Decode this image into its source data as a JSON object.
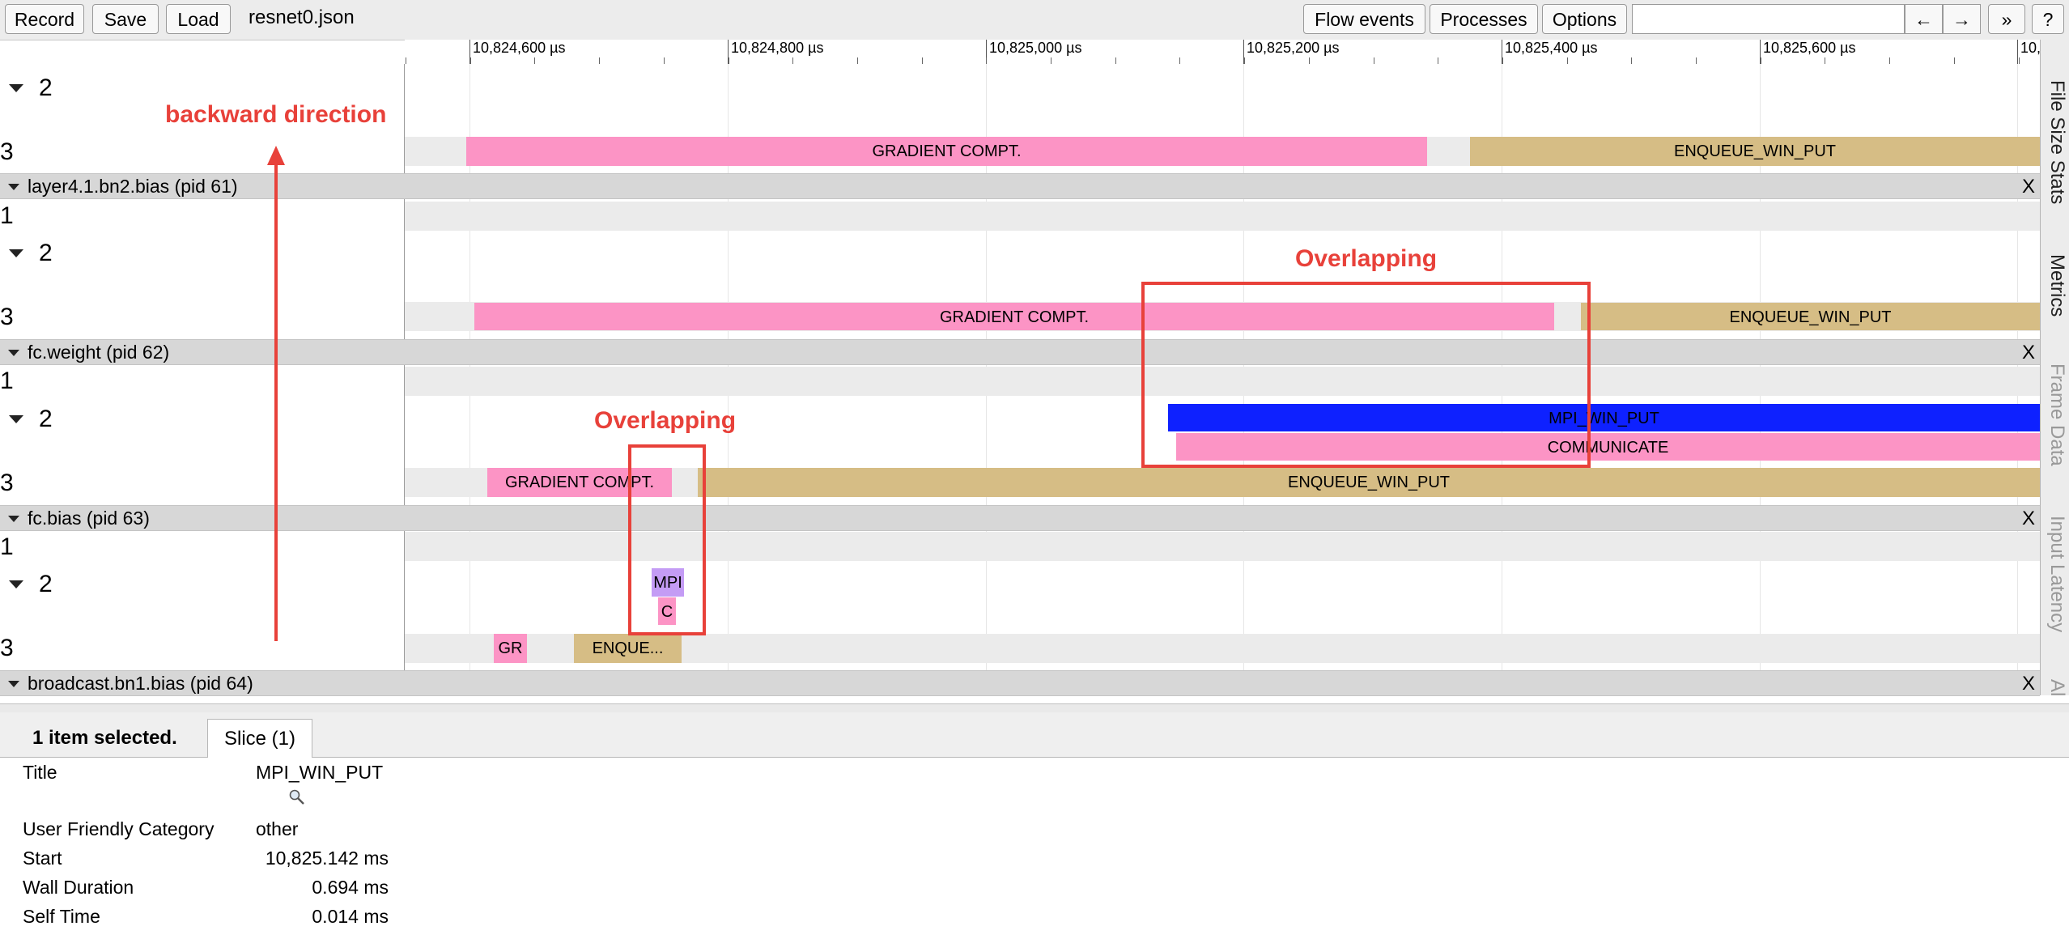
{
  "toolbar": {
    "record_label": "Record",
    "save_label": "Save",
    "load_label": "Load",
    "filename": "resnet0.json",
    "flow_events_label": "Flow events",
    "processes_label": "Processes",
    "options_label": "Options",
    "search_value": "",
    "prev_label": "←",
    "next_label": "→",
    "more_label": "»",
    "help_label": "?"
  },
  "ruler": {
    "ticks": [
      "10,824,600 µs",
      "10,824,800 µs",
      "10,825,000 µs",
      "10,825,200 µs",
      "10,825,400 µs",
      "10,825,600 µs",
      "10,"
    ]
  },
  "tracks": {
    "top": {
      "thread2": "2",
      "thread3": "3"
    },
    "pid61": {
      "label": "layer4.1.bn2.bias (pid 61)",
      "t1": "1",
      "t2": "2",
      "t3": "3",
      "close": "X"
    },
    "pid62": {
      "label": "fc.weight (pid 62)",
      "t1": "1",
      "t2": "2",
      "t3": "3",
      "close": "X"
    },
    "pid63": {
      "label": "fc.bias (pid 63)",
      "t1": "1",
      "t2": "2",
      "t3": "3",
      "close": "X"
    },
    "pid64": {
      "label": "broadcast.bn1.bias (pid 64)",
      "close": "X"
    }
  },
  "slices": {
    "s1": "GRADIENT COMPT.",
    "s2": "ENQUEUE_WIN_PUT",
    "s3": "GRADIENT COMPT.",
    "s4": "ENQUEUE_WIN_PUT",
    "s5": "MPI_WIN_PUT",
    "s6": "COMMUNICATE",
    "s7": "GRADIENT COMPT.",
    "s8": "ENQUEUE_WIN_PUT",
    "s9": "MPI",
    "s10": "C",
    "s11": "GR",
    "s12": "ENQUE..."
  },
  "colors": {
    "gradient": "#fc94c5",
    "enqueue": "#d6bd85",
    "mpi_win_put": "#0e21ff",
    "mpi_small": "#c49cf5",
    "annotation": "#e8413a"
  },
  "annotations": {
    "backward": "backward direction",
    "overlap_right": "Overlapping",
    "overlap_left": "Overlapping"
  },
  "side_tabs": [
    "File Size Stats",
    "Metrics",
    "Frame Data",
    "Input Latency",
    "Al"
  ],
  "panel": {
    "selected": "1 item selected.",
    "tab": "Slice (1)",
    "rows": [
      {
        "label": "Title",
        "value": "MPI_WIN_PUT"
      },
      {
        "label": "User Friendly Category",
        "value": "other"
      },
      {
        "label": "Start",
        "value": "10,825.142 ms"
      },
      {
        "label": "Wall Duration",
        "value": "0.694 ms"
      },
      {
        "label": "Self Time",
        "value": "0.014 ms"
      }
    ],
    "magnifier_icon": "magnifier-icon"
  }
}
